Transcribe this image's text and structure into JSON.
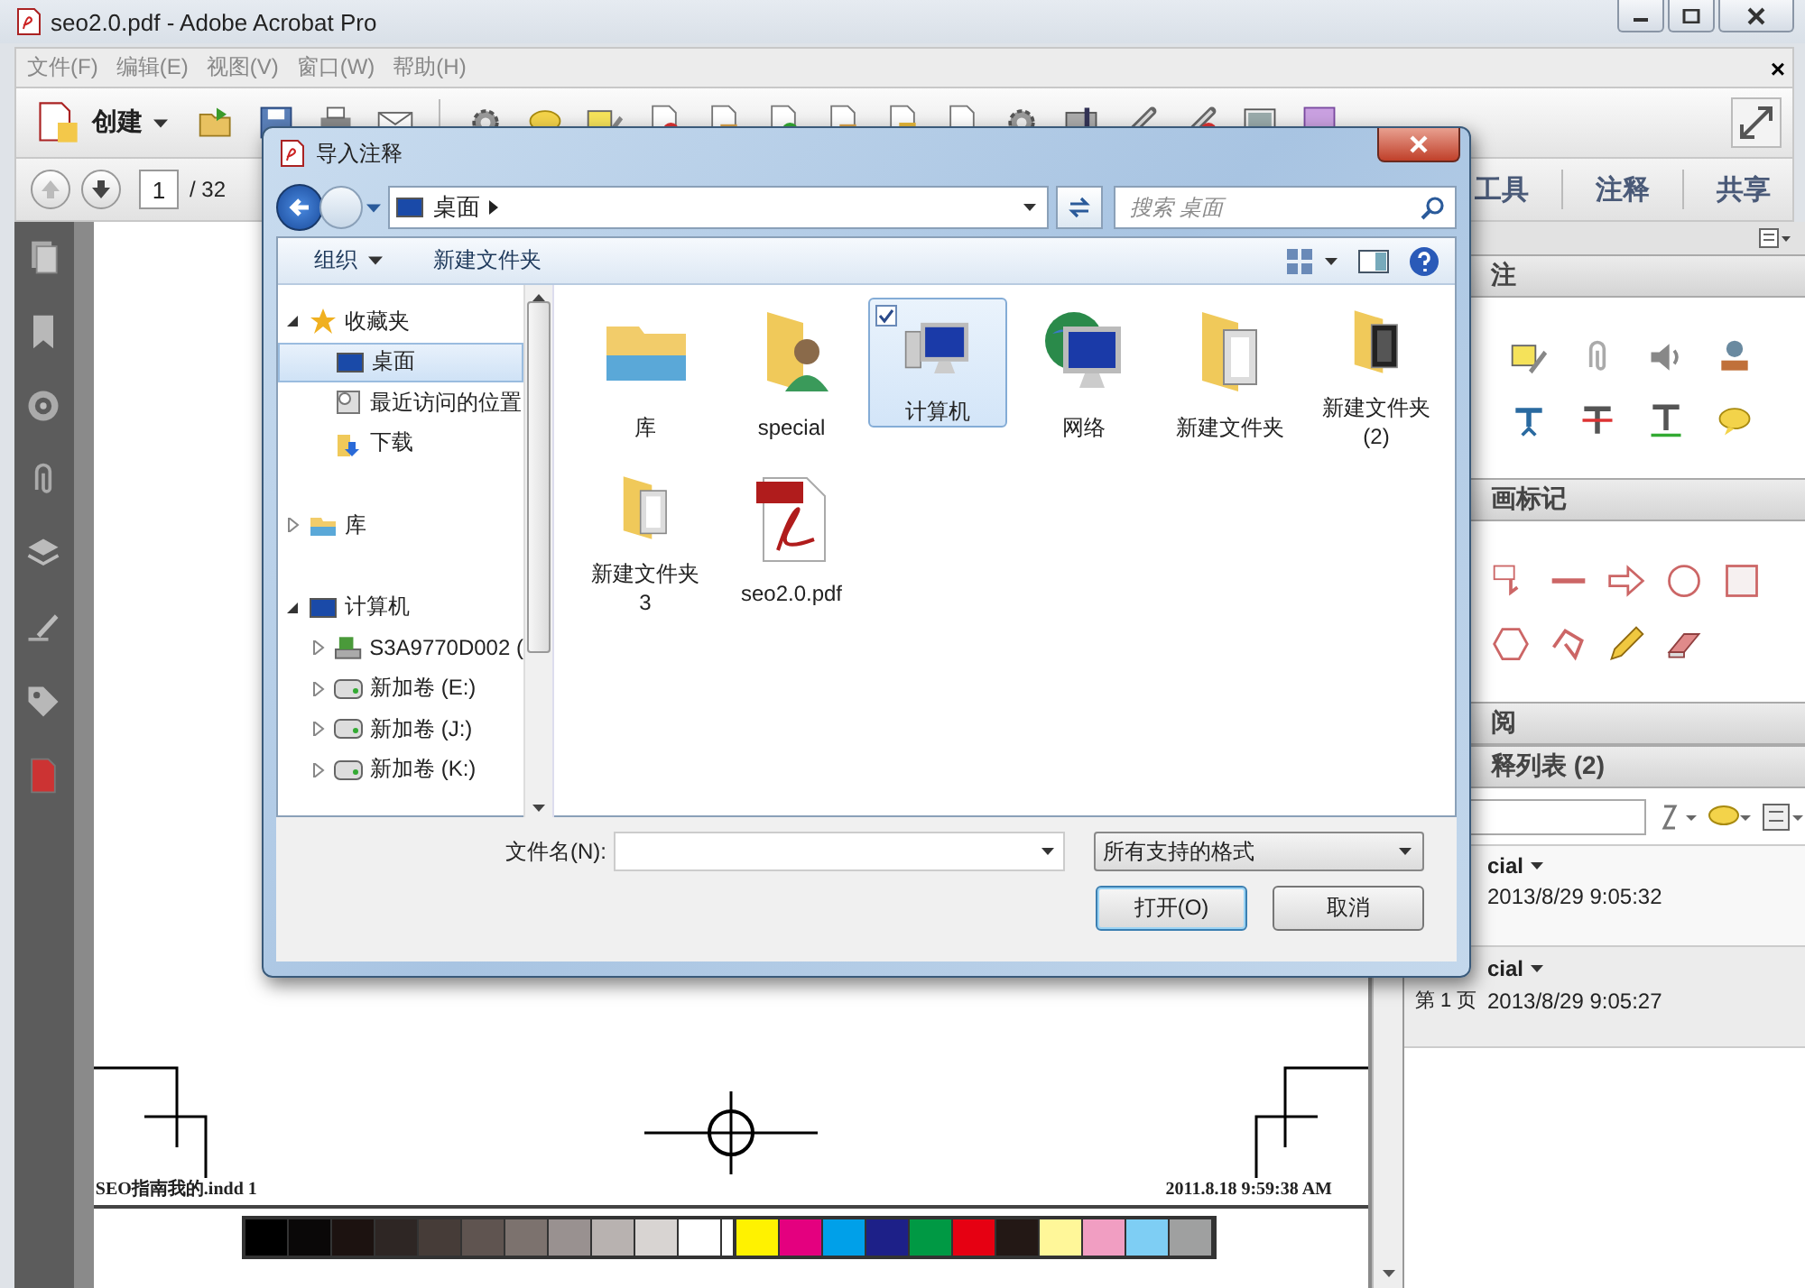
{
  "window": {
    "title": "seo2.0.pdf - Adobe Acrobat Pro"
  },
  "menu": [
    {
      "label": "文件(F)"
    },
    {
      "label": "编辑(E)"
    },
    {
      "label": "视图(V)"
    },
    {
      "label": "窗口(W)"
    },
    {
      "label": "帮助(H)"
    }
  ],
  "menu_close": "×",
  "toolbar": {
    "create_label": "创建"
  },
  "nav": {
    "page": "1",
    "page_count": "/ 32"
  },
  "panel_tabs": [
    {
      "label": "工具"
    },
    {
      "label": "注释"
    },
    {
      "label": "共享"
    }
  ],
  "right_panel": {
    "sections": [
      {
        "title": "注",
        "kind": "annotations"
      },
      {
        "title": "画标记",
        "kind": "drawing"
      },
      {
        "title": "阅",
        "kind": "review"
      },
      {
        "title": "释列表 (2)",
        "kind": "comments"
      }
    ],
    "comments": [
      {
        "author": "cial",
        "time": "2013/8/29 9:05:32"
      },
      {
        "author": "cial",
        "page": "第 1 页",
        "time": "2013/8/29 9:05:27"
      }
    ]
  },
  "document": {
    "footer_left": "SEO指南我的.indd  1",
    "footer_right": "2011.8.18  9:59:38 AM",
    "swatches": [
      {
        "color": "#000000"
      },
      {
        "color": "#0a0808"
      },
      {
        "color": "#1c1210"
      },
      {
        "color": "#2e2624"
      },
      {
        "color": "#463c38"
      },
      {
        "color": "#5f5450"
      },
      {
        "color": "#7c726e"
      },
      {
        "color": "#999190"
      },
      {
        "color": "#b8b2b0"
      },
      {
        "color": "#d8d4d2"
      },
      {
        "color": "#ffffff"
      },
      {
        "color": "#fff200"
      },
      {
        "color": "#e4007f"
      },
      {
        "color": "#00a0e9"
      },
      {
        "color": "#1d2088"
      },
      {
        "color": "#009944"
      },
      {
        "color": "#e60012"
      },
      {
        "color": "#231815"
      },
      {
        "color": "#fff799"
      },
      {
        "color": "#f19ec2"
      },
      {
        "color": "#7ecef4"
      },
      {
        "color": "#9fa0a0"
      }
    ]
  },
  "dialog": {
    "title": "导入注释",
    "location": "桌面",
    "search_placeholder": "搜索 桌面",
    "organize": "组织",
    "new_folder": "新建文件夹",
    "tree": [
      {
        "label": "收藏夹",
        "kind": "favorites",
        "expanded": true,
        "selected": false,
        "children": [
          {
            "label": "桌面",
            "kind": "desktop",
            "selected": true
          },
          {
            "label": "最近访问的位置",
            "kind": "recent",
            "selected": false
          },
          {
            "label": "下载",
            "kind": "downloads",
            "selected": false
          }
        ]
      },
      {
        "label": "库",
        "kind": "library",
        "expanded": false,
        "selected": false
      },
      {
        "label": "计算机",
        "kind": "computer",
        "expanded": true,
        "selected": false,
        "children": [
          {
            "label": "S3A9770D002 (",
            "kind": "system-drive",
            "expanded": false,
            "selected": false
          },
          {
            "label": "新加卷 (E:)",
            "kind": "drive",
            "expanded": false,
            "selected": false
          },
          {
            "label": "新加卷 (J:)",
            "kind": "drive",
            "expanded": false,
            "selected": false
          },
          {
            "label": "新加卷 (K:)",
            "kind": "drive",
            "expanded": false,
            "selected": false
          }
        ]
      }
    ],
    "files": [
      {
        "name": "库",
        "kind": "library",
        "selected": false,
        "checked": false
      },
      {
        "name": "special",
        "kind": "user-folder",
        "selected": false,
        "checked": false
      },
      {
        "name": "计算机",
        "kind": "computer",
        "selected": true,
        "checked": true
      },
      {
        "name": "网络",
        "kind": "network",
        "selected": false,
        "checked": false
      },
      {
        "name": "新建文件夹",
        "kind": "folder",
        "selected": false,
        "checked": false
      },
      {
        "name": "新建文件夹 (2)",
        "kind": "folder-dark",
        "selected": false,
        "checked": false
      },
      {
        "name": "新建文件夹 3",
        "kind": "folder",
        "selected": false,
        "checked": false
      },
      {
        "name": "seo2.0.pdf",
        "kind": "pdf",
        "selected": false,
        "checked": false
      }
    ],
    "filename_label": "文件名(N):",
    "filter": "所有支持的格式",
    "buttons": [
      {
        "label": "打开(O)",
        "kind": "default"
      },
      {
        "label": "取消",
        "kind": "normal"
      }
    ]
  }
}
